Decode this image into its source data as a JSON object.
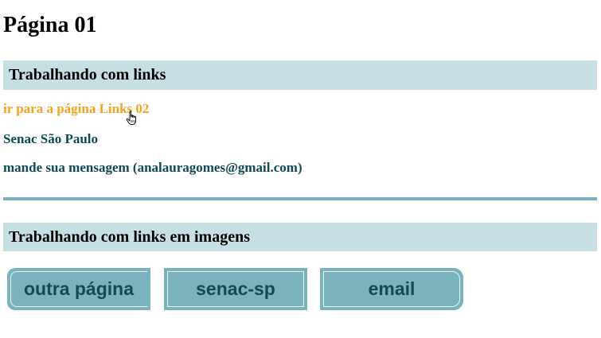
{
  "page": {
    "title": "Página 01"
  },
  "sections": [
    {
      "heading": "Trabalhando com links"
    },
    {
      "heading": "Trabalhando com links em imagens"
    }
  ],
  "links": {
    "links02": "ir para a página Links 02",
    "senac": "Senac São Paulo",
    "mail": "mande sua mensagem (analauragomes@gmail.com)"
  },
  "image_buttons": [
    {
      "label": "outra página"
    },
    {
      "label": "senac-sp"
    },
    {
      "label": "email"
    }
  ],
  "cursor": {
    "icon": "hand-pointer-icon"
  },
  "colors": {
    "header_bg": "#c7dfe3",
    "link": "#0d4a54",
    "link_hover": "#f4a21e",
    "button_bg": "#7ab3bd",
    "button_text": "#134a55",
    "divider": "#7ab3bd"
  }
}
